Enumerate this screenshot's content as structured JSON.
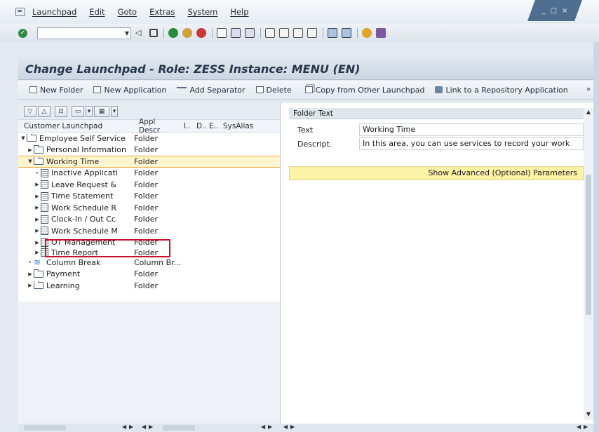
{
  "menubar": {
    "items": [
      "Launchpad",
      "Edit",
      "Goto",
      "Extras",
      "System",
      "Help"
    ]
  },
  "window_controls": {
    "minimize": "_",
    "maximize": "□",
    "close": "×"
  },
  "toolbar": {
    "command_field_value": "",
    "icons": [
      "back-icon",
      "save-icon",
      "back-green-icon",
      "exit-icon",
      "cancel-icon",
      "print-icon",
      "find-icon",
      "find-next-icon",
      "first-page-icon",
      "prev-page-icon",
      "next-page-icon",
      "last-page-icon",
      "new-session-icon",
      "shortcut-icon",
      "help-icon",
      "layout-icon"
    ]
  },
  "title": "Change Launchpad - Role: ZESS Instance: MENU (EN)",
  "app_toolbar": {
    "new_folder": "New Folder",
    "new_application": "New Application",
    "add_separator": "Add Separator",
    "delete": "Delete",
    "copy_from_other": "Copy from Other Launchpad",
    "link_repository": "Link to a Repository Application",
    "more": "»"
  },
  "tree": {
    "tools": [
      "▽",
      "△",
      "⊡",
      "▭",
      "▾",
      "▦",
      "▾"
    ],
    "columns": {
      "name": "Customer Launchpad",
      "desc": "Appl Descr",
      "i": "I..",
      "d": "D..",
      "e": "E..",
      "sysalias": "SysAlias"
    },
    "rows": [
      {
        "name": "Employee Self Service",
        "desc": "Folder"
      },
      {
        "name": "Personal Information",
        "desc": "Folder"
      },
      {
        "name": "Working Time",
        "desc": "Folder"
      },
      {
        "name": "Inactive Applicati",
        "desc": "Folder"
      },
      {
        "name": "Leave Request &",
        "desc": "Folder"
      },
      {
        "name": "Time Statement",
        "desc": "Folder"
      },
      {
        "name": "Work Schedule R",
        "desc": "Folder"
      },
      {
        "name": "Clock-In / Out Cc",
        "desc": "Folder"
      },
      {
        "name": "Work Schedule M",
        "desc": "Folder"
      },
      {
        "name": "OT Management",
        "desc": "Folder"
      },
      {
        "name": "Time Report",
        "desc": "Folder"
      },
      {
        "name": "Column Break",
        "desc": "Column Br..."
      },
      {
        "name": "Payment",
        "desc": "Folder"
      },
      {
        "name": "Learning",
        "desc": "Folder"
      }
    ]
  },
  "details": {
    "header": "Folder Text",
    "text_label": "Text",
    "text_value": "Working Time",
    "desc_label": "Descript.",
    "desc_value": "In this area, you can use services to record your work",
    "advanced_button": "Show Advanced (Optional) Parameters"
  }
}
